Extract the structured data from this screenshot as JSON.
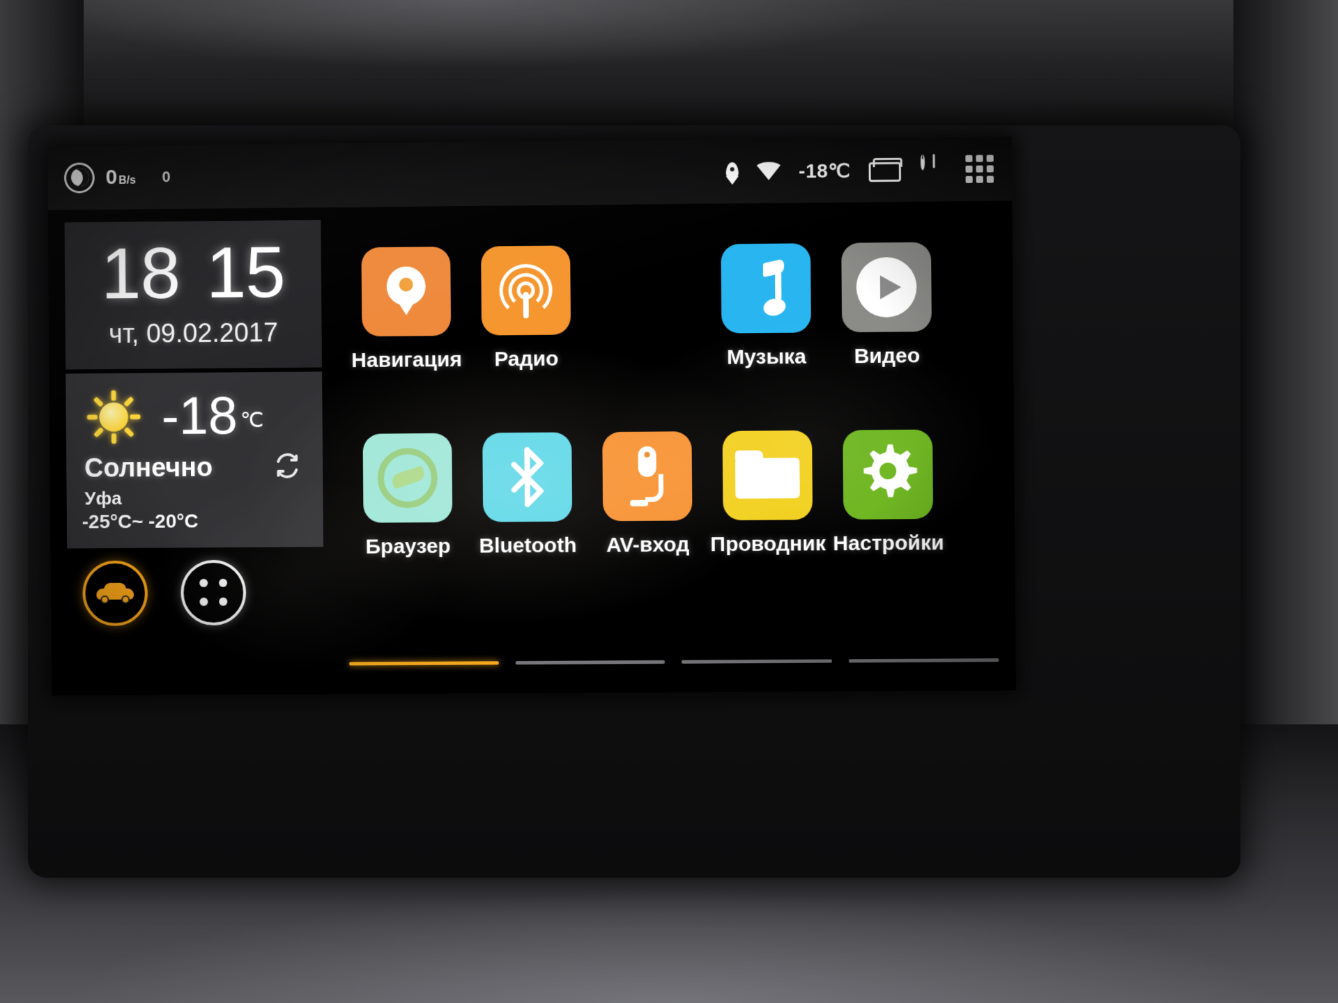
{
  "statusbar": {
    "mode_icon": "moon-icon",
    "network_rate": "0",
    "network_unit": "B/s",
    "network_count": "0",
    "location_icon": "location-pin-icon",
    "wifi_icon": "wifi-icon",
    "temperature": "-18℃",
    "recents_icon": "recents-icon",
    "power_icon": "power-icon",
    "apps_icon": "app-grid-icon"
  },
  "clock": {
    "hours": "18",
    "minutes": "15",
    "date": "чт, 09.02.2017"
  },
  "weather": {
    "icon": "sun-icon",
    "temperature": "-18",
    "degree_unit": "℃",
    "condition": "Солнечно",
    "city": "Уфа",
    "range": "-25°C~ -20°C",
    "refresh_icon": "refresh-icon"
  },
  "quick_buttons": [
    {
      "name": "car-settings-button",
      "icon": "car-icon",
      "color": "#ffaa1a"
    },
    {
      "name": "all-apps-button",
      "icon": "apps-dots-icon",
      "color": "#f0f0f0"
    }
  ],
  "apps": {
    "row1": [
      {
        "label": "Навигация",
        "icon": "navigation-pin-icon",
        "color": "#ef8a3c",
        "name": "app-navigation"
      },
      {
        "label": "Радио",
        "icon": "radio-waves-icon",
        "color": "#f5962f",
        "name": "app-radio"
      },
      {
        "label": "",
        "icon": "",
        "color": "",
        "name": "app-empty-slot"
      },
      {
        "label": "Музыка",
        "icon": "music-note-icon",
        "color": "#29b6f0",
        "name": "app-music"
      },
      {
        "label": "Видео",
        "icon": "video-play-icon",
        "color": "#8b8b88",
        "name": "app-video"
      }
    ],
    "row2": [
      {
        "label": "Браузер",
        "icon": "browser-compass-icon",
        "color": "#9fe7d8",
        "name": "app-browser"
      },
      {
        "label": "Bluetooth",
        "icon": "bluetooth-icon",
        "color": "#5fd8e8",
        "name": "app-bluetooth"
      },
      {
        "label": "AV-вход",
        "icon": "av-input-icon",
        "color": "#f79233",
        "name": "app-av-input"
      },
      {
        "label": "Проводник",
        "icon": "folder-icon",
        "color": "#f2d01e",
        "name": "app-file-manager"
      },
      {
        "label": "Настройки",
        "icon": "gear-icon",
        "color": "#6cb51e",
        "name": "app-settings"
      }
    ]
  },
  "pager": {
    "pages": 4,
    "active_index": 0,
    "active_color": "#ffb01f"
  }
}
